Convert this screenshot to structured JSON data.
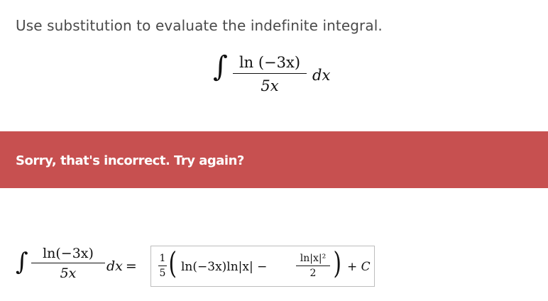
{
  "question": {
    "instruction": "Use substitution to evaluate the indefinite integral."
  },
  "problem": {
    "integral_sign": "∫",
    "numerator": "ln (−3x)",
    "denominator": "5x",
    "differential": "dx"
  },
  "feedback": {
    "message": "Sorry, that's incorrect. Try again?",
    "color": "#c75050"
  },
  "answer": {
    "integral_sign": "∫",
    "numerator": "ln(−3x)",
    "denominator": "5x",
    "differential": "dx",
    "equals": "=",
    "input": {
      "coef_num": "1",
      "coef_den": "5",
      "open_paren": "(",
      "term1": "ln(−3x)ln|x| −",
      "frac_num": "ln|x|²",
      "frac_den": "2",
      "close_paren": ")",
      "plus": "+",
      "constant": "C"
    }
  }
}
